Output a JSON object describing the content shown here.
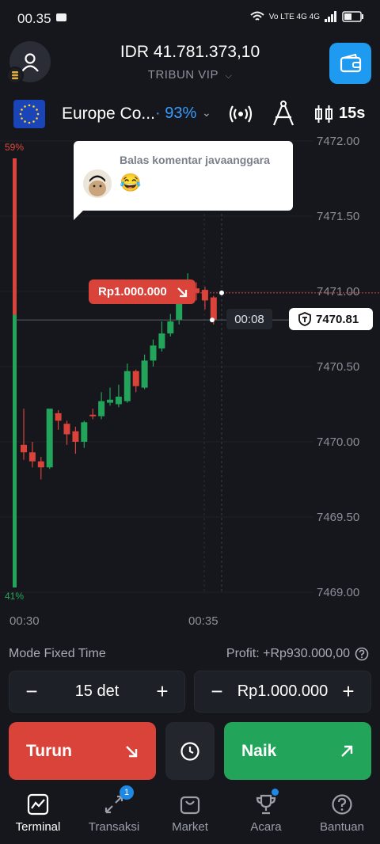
{
  "status_bar": {
    "time": "00.35",
    "network": "Vo LTE  4G  4G"
  },
  "header": {
    "balance": "IDR 41.781.373,10",
    "account": "TRIBUN VIP",
    "account_chevron": "chevron-down-icon"
  },
  "asset": {
    "name": "Europe Co...",
    "separator": "·",
    "payout": "93%",
    "timeframe": "15s"
  },
  "chart_data": {
    "type": "candlestick",
    "y_ticks": [
      "7472.00",
      "7471.50",
      "7471.00",
      "7470.50",
      "7470.00",
      "7469.50",
      "7469.00"
    ],
    "ylim": [
      7469.0,
      7472.0
    ],
    "x_ticks": [
      "00:30",
      "00:35"
    ],
    "sentiment_top": "59%",
    "sentiment_bottom": "41%",
    "current_price": "7470.81",
    "timer": "00:08",
    "trade_amount": "Rp1.000.000",
    "candles": [
      {
        "o": 7469.98,
        "c": 7469.93,
        "h": 7470.22,
        "l": 7469.88
      },
      {
        "o": 7469.93,
        "c": 7469.87,
        "h": 7470.0,
        "l": 7469.83
      },
      {
        "o": 7469.87,
        "c": 7469.83,
        "h": 7469.9,
        "l": 7469.75
      },
      {
        "o": 7469.83,
        "c": 7470.22,
        "h": 7470.22,
        "l": 7469.82
      },
      {
        "o": 7470.19,
        "c": 7470.14,
        "h": 7470.21,
        "l": 7470.08
      },
      {
        "o": 7470.12,
        "c": 7470.05,
        "h": 7470.14,
        "l": 7469.98
      },
      {
        "o": 7470.07,
        "c": 7470.0,
        "h": 7470.1,
        "l": 7469.92
      },
      {
        "o": 7470.0,
        "c": 7470.13,
        "h": 7470.14,
        "l": 7469.96
      },
      {
        "o": 7470.18,
        "c": 7470.17,
        "h": 7470.22,
        "l": 7470.15
      },
      {
        "o": 7470.17,
        "c": 7470.27,
        "h": 7470.33,
        "l": 7470.15
      },
      {
        "o": 7470.26,
        "c": 7470.28,
        "h": 7470.36,
        "l": 7470.24
      },
      {
        "o": 7470.25,
        "c": 7470.3,
        "h": 7470.38,
        "l": 7470.23
      },
      {
        "o": 7470.27,
        "c": 7470.47,
        "h": 7470.52,
        "l": 7470.26
      },
      {
        "o": 7470.47,
        "c": 7470.37,
        "h": 7470.48,
        "l": 7470.33
      },
      {
        "o": 7470.36,
        "c": 7470.54,
        "h": 7470.58,
        "l": 7470.35
      },
      {
        "o": 7470.54,
        "c": 7470.64,
        "h": 7470.68,
        "l": 7470.5
      },
      {
        "o": 7470.62,
        "c": 7470.72,
        "h": 7470.8,
        "l": 7470.6
      },
      {
        "o": 7470.72,
        "c": 7470.8,
        "h": 7470.85,
        "l": 7470.7
      },
      {
        "o": 7470.81,
        "c": 7470.94,
        "h": 7471.04,
        "l": 7470.78
      },
      {
        "o": 7470.97,
        "c": 7471.02,
        "h": 7471.12,
        "l": 7470.95
      },
      {
        "o": 7471.02,
        "c": 7470.99,
        "h": 7471.06,
        "l": 7470.94
      },
      {
        "o": 7471.01,
        "c": 7470.94,
        "h": 7471.03,
        "l": 7470.88
      },
      {
        "o": 7470.96,
        "c": 7470.81,
        "h": 7470.97,
        "l": 7470.78
      }
    ]
  },
  "comment": {
    "title": "Balas komentar javaanggara",
    "emoji": "😂"
  },
  "controls": {
    "mode": "Mode Fixed Time",
    "profit": "Profit: +Rp930.000,00",
    "duration": "15 det",
    "amount": "Rp1.000.000",
    "minus": "−",
    "plus": "+",
    "down_label": "Turun",
    "up_label": "Naik"
  },
  "nav": {
    "items": [
      {
        "label": "Terminal",
        "icon": "terminal-chart-icon"
      },
      {
        "label": "Transaksi",
        "icon": "trades-arrows-icon",
        "badge": "1"
      },
      {
        "label": "Market",
        "icon": "market-bag-icon"
      },
      {
        "label": "Acara",
        "icon": "trophy-icon"
      },
      {
        "label": "Bantuan",
        "icon": "help-icon"
      }
    ]
  },
  "colors": {
    "accent": "#1e9bf0",
    "down": "#d9433a",
    "up": "#22a45a",
    "background": "#15171c"
  }
}
